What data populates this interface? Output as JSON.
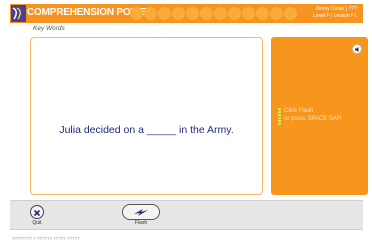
{
  "header": {
    "title": "COMPREHENSION POWER",
    "info_line1": "Jimmy Coder | ???",
    "info_line2": "Level F | Lesson F1",
    "background_color": "#f79320"
  },
  "subtitle": "Key Words",
  "sentence": {
    "before_blank": "Julia decided on a",
    "blank": "_____",
    "after_blank": "in the Army."
  },
  "side_panel": {
    "instruction_line1": "Click Flash",
    "instruction_line2": "or press SPACE BAR",
    "speaker_icon": "speaker-icon",
    "color": "#f7951d"
  },
  "toolbar": {
    "quit_label": "Quit",
    "flash_label": "Flash"
  },
  "footer": {
    "text": "???????? ? ?????? ????? ?????"
  }
}
